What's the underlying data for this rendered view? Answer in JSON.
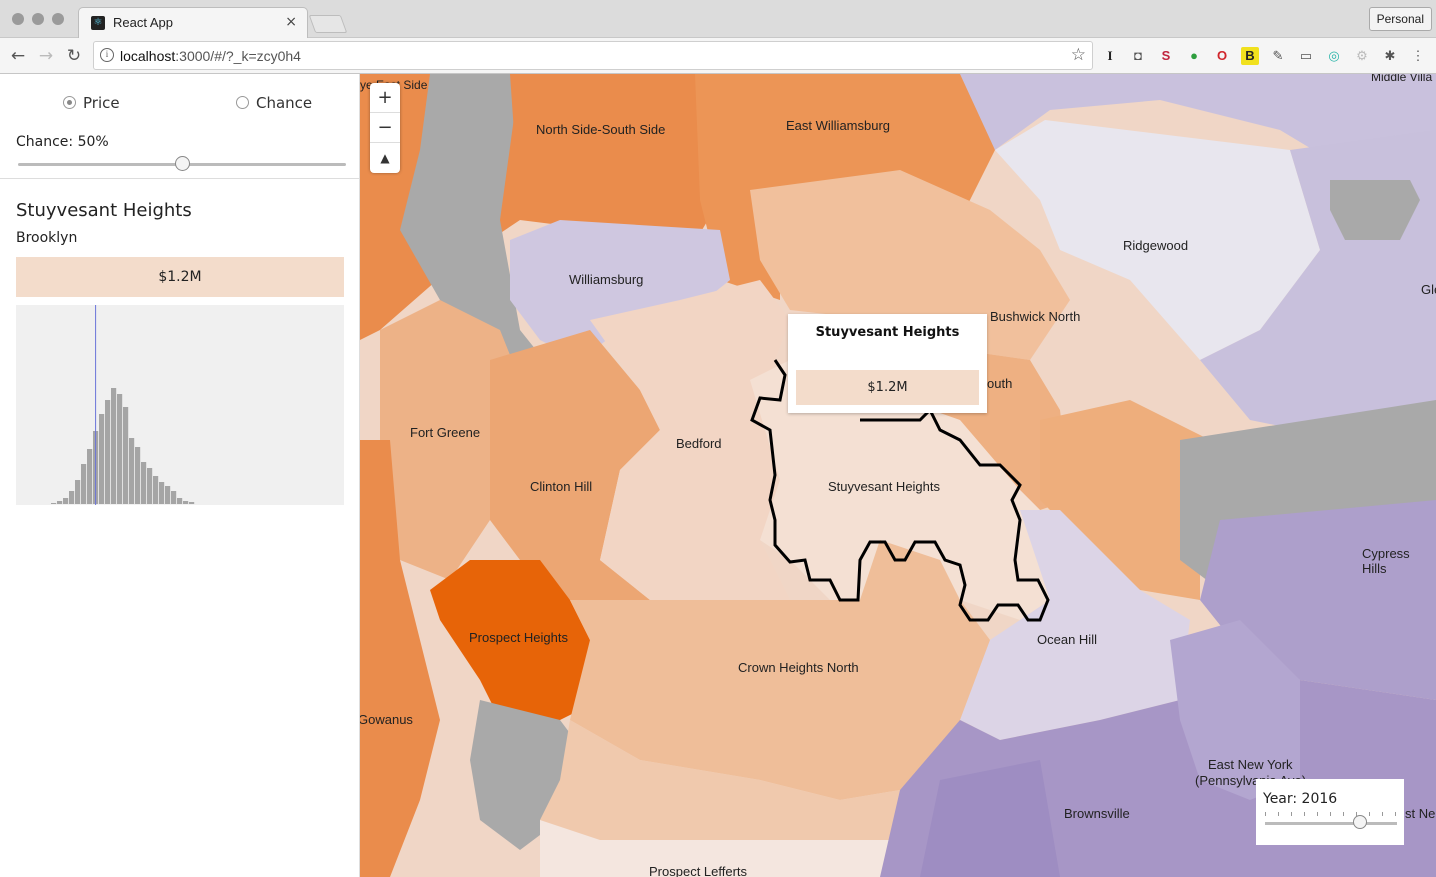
{
  "browser": {
    "tab_title": "React App",
    "tab_close": "×",
    "url_host": "localhost",
    "url_rest": ":3000/#/?_k=zcy0h4",
    "profile": "Personal"
  },
  "sidebar": {
    "mode_options": [
      {
        "label": "Price",
        "selected": true
      },
      {
        "label": "Chance",
        "selected": false
      }
    ],
    "chance_label": "Chance: 50%",
    "chance_value": 0.5,
    "selected": {
      "name": "Stuyvesant Heights",
      "borough": "Brooklyn",
      "price": "$1.2M"
    }
  },
  "histogram": {
    "bins": [
      1,
      3,
      6,
      13,
      24,
      40,
      55,
      73,
      90,
      104,
      116,
      110,
      97,
      66,
      57,
      42,
      36,
      28,
      22,
      18,
      13,
      6,
      3,
      2
    ],
    "marker_bin": 7
  },
  "map": {
    "zoom_in": "+",
    "zoom_out": "−",
    "reset_north": "▲",
    "labels": [
      "North Side-South Side",
      "East Williamsburg",
      "Ridgewood",
      "Williamsburg",
      "Bushwick North",
      "Fort Greene",
      "Bedford",
      "Clinton Hill",
      "Stuyvesant Heights",
      "Prospect Heights",
      "Crown Heights North",
      "Ocean Hill",
      "Gowanus",
      "East New York",
      "(Pennsylvania Ave)",
      "Brownsville",
      "Prospect Lefferts",
      "Cypress Hills",
      "Middle Villa",
      "Gle",
      "st Ne",
      "outh",
      "ye East Side"
    ],
    "popup": {
      "title": "Stuyvesant Heights",
      "price": "$1.2M"
    },
    "year_label": "Year: 2016",
    "year_value": 2016
  }
}
